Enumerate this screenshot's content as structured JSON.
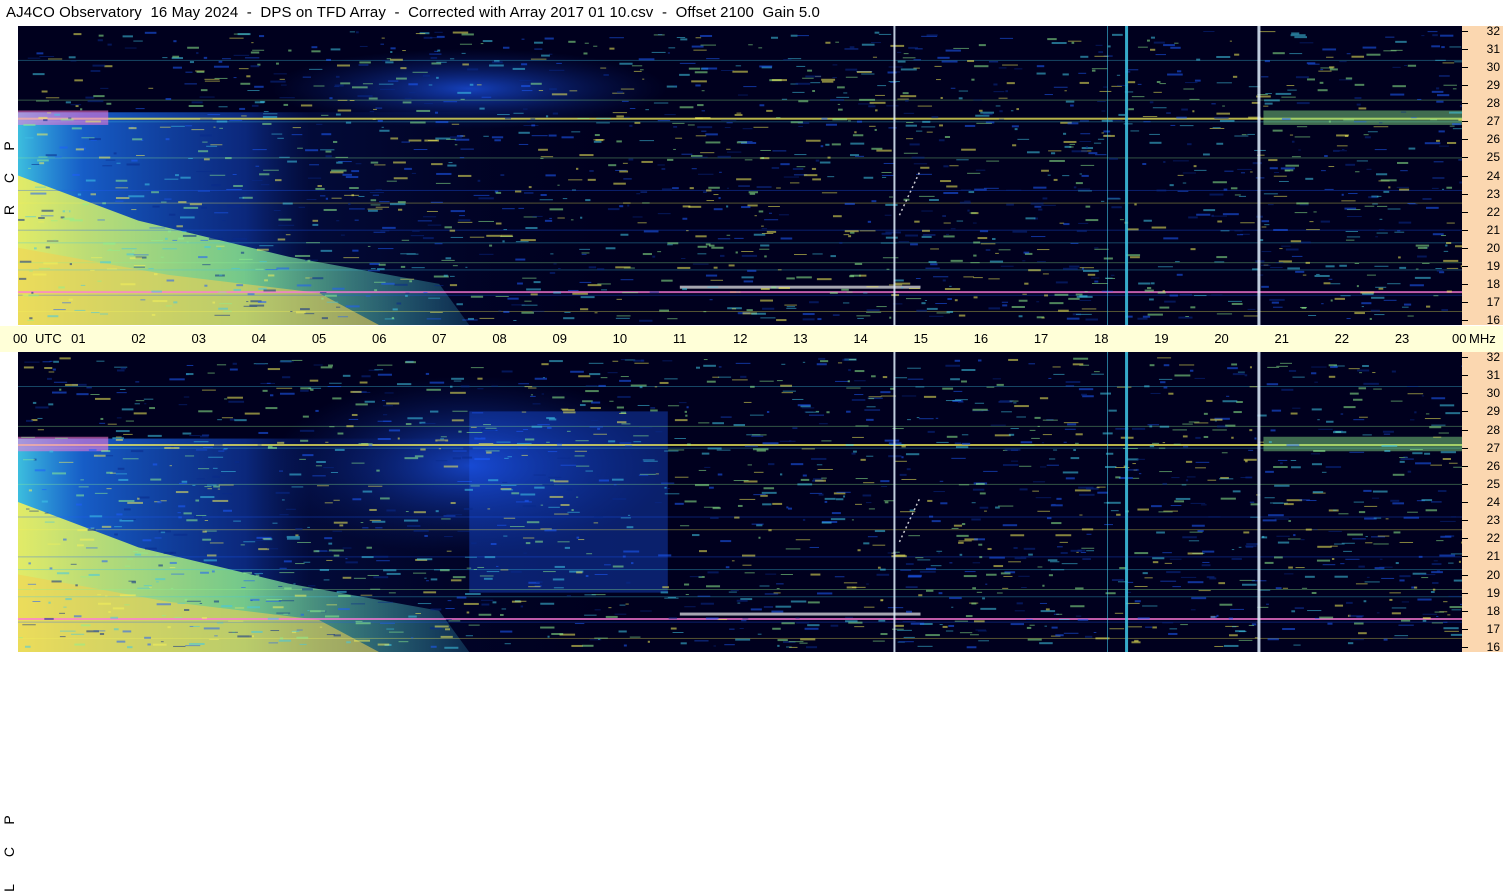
{
  "title": "AJ4CO Observatory  16 May 2024  -  DPS on TFD Array  -  Corrected with Array 2017 01 10.csv  -  Offset 2100  Gain 5.0",
  "panels": [
    {
      "id": "rcp",
      "label": [
        "R",
        "C",
        "P"
      ]
    },
    {
      "id": "lcp",
      "label": [
        "L",
        "C",
        "P"
      ]
    }
  ],
  "time_axis": {
    "start_label": "00",
    "unit_label": "UTC",
    "hour_labels": [
      "01",
      "02",
      "03",
      "04",
      "05",
      "06",
      "07",
      "08",
      "09",
      "10",
      "11",
      "12",
      "13",
      "14",
      "15",
      "16",
      "17",
      "18",
      "19",
      "20",
      "21",
      "22",
      "23"
    ],
    "end_label": "00",
    "freq_unit": "MHz"
  },
  "freq_axis": {
    "labels": [
      "32",
      "31",
      "30",
      "29",
      "28",
      "27",
      "26",
      "25",
      "24",
      "23",
      "22",
      "21",
      "20",
      "19",
      "18",
      "17",
      "16"
    ]
  },
  "chart_data": {
    "type": "heatmap",
    "title": "AJ4CO Observatory  16 May 2024  -  DPS on TFD Array  -  Corrected with Array 2017 01 10.csv  -  Offset 2100  Gain 5.0",
    "x_axis": {
      "label": "UTC",
      "range": [
        0,
        24
      ],
      "unit": "hours"
    },
    "y_axis": {
      "label": "MHz",
      "range": [
        16,
        32
      ]
    },
    "panels": [
      "RCP",
      "LCP"
    ],
    "colormap": [
      "#00001e",
      "#0a2a8a",
      "#1e5cff",
      "#3fc8e8",
      "#8ef08e",
      "#f4f05a",
      "#ff7ad8",
      "#ffffff"
    ],
    "features": {
      "daytime_noise_hours": [
        0,
        10.8
      ],
      "vertical_interference_hours": [
        14.55,
        18.4,
        20.6
      ],
      "strong_bands_mhz": [
        27.2,
        17.6
      ]
    }
  }
}
